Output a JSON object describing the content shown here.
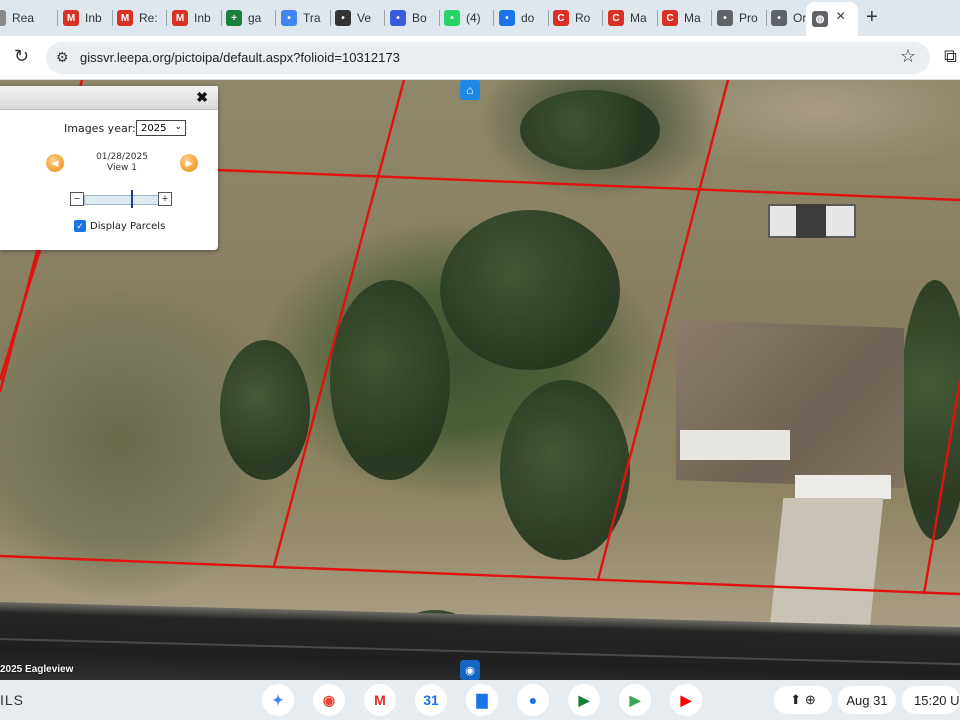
{
  "browser": {
    "tabs": [
      {
        "label": "Rea",
        "favicon": "page-icon",
        "color": "#8a8a8a"
      },
      {
        "label": "Inb",
        "favicon": "gmail-icon",
        "color": "#d93025"
      },
      {
        "label": "Re:",
        "favicon": "gmail-icon",
        "color": "#d93025"
      },
      {
        "label": "Inb",
        "favicon": "gmail-icon",
        "color": "#d93025"
      },
      {
        "label": "ga",
        "favicon": "sheets-icon",
        "color": "#188038"
      },
      {
        "label": "Tra",
        "favicon": "translate-icon",
        "color": "#4285f4"
      },
      {
        "label": "Ve",
        "favicon": "openai-icon",
        "color": "#333333"
      },
      {
        "label": "Bo",
        "favicon": "bolt-icon",
        "color": "#3b5bdb"
      },
      {
        "label": "(4)",
        "favicon": "whatsapp-icon",
        "color": "#25d366"
      },
      {
        "label": "do",
        "favicon": "smile-icon",
        "color": "#1a73e8"
      },
      {
        "label": "Ro",
        "favicon": "c-icon",
        "color": "#d93025"
      },
      {
        "label": "Ma",
        "favicon": "c-icon",
        "color": "#d93025"
      },
      {
        "label": "Ma",
        "favicon": "c-icon",
        "color": "#d93025"
      },
      {
        "label": "Pro",
        "favicon": "globe-icon",
        "color": "#5f6368"
      },
      {
        "label": "On",
        "favicon": "globe-icon",
        "color": "#5f6368"
      }
    ],
    "active_tab": {
      "favicon": "globe-icon",
      "close": "×"
    },
    "new_tab": "+",
    "url": "gissvr.leepa.org/pictoipa/default.aspx?folioid=10312173"
  },
  "panel": {
    "close": "✖",
    "images_year_label": "Images year:",
    "images_year_value": "2025",
    "date": "01/28/2025",
    "view": "View 1",
    "slider_minus": "−",
    "slider_plus": "+",
    "slider_value": 0.62,
    "display_parcels_label": "Display Parcels",
    "display_parcels_checked": true
  },
  "map": {
    "copyright": "2025 Eagleview"
  },
  "shelf": {
    "left_text": "ILS",
    "apps": [
      {
        "name": "gemini-icon",
        "color": "#4285f4",
        "glyph": "✦"
      },
      {
        "name": "chrome-icon",
        "color": "#ea4335",
        "glyph": "◉"
      },
      {
        "name": "gmail-icon",
        "color": "#d93025",
        "glyph": "M"
      },
      {
        "name": "calendar-icon",
        "color": "#1a73e8",
        "glyph": "31"
      },
      {
        "name": "files-icon",
        "color": "#1a73e8",
        "glyph": "▇"
      },
      {
        "name": "messages-icon",
        "color": "#1a73e8",
        "glyph": "●"
      },
      {
        "name": "meet-icon",
        "color": "#188038",
        "glyph": "▶"
      },
      {
        "name": "play-store-icon",
        "color": "#34a853",
        "glyph": "▶"
      },
      {
        "name": "youtube-icon",
        "color": "#ff0000",
        "glyph": "▶"
      }
    ],
    "date": "Aug 31",
    "time": "15:20",
    "time_suffix": "U"
  }
}
